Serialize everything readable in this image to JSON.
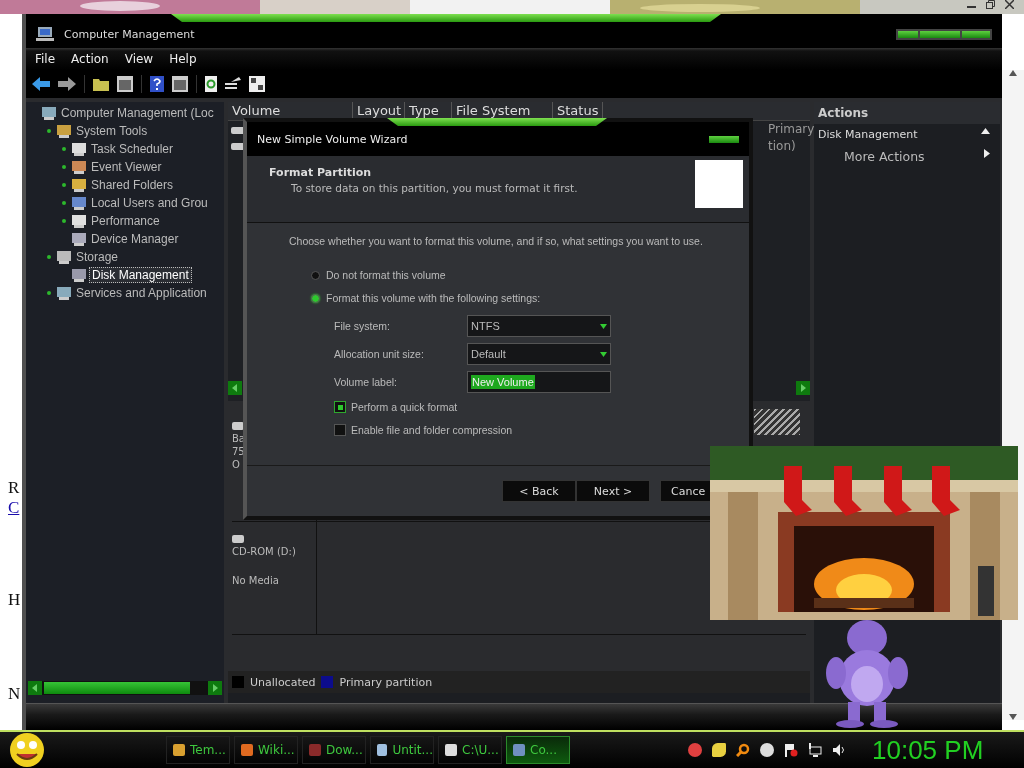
{
  "background_page": {
    "fragments": [
      "R",
      "C",
      "H",
      "N"
    ]
  },
  "window": {
    "title": "Computer Management",
    "menu": [
      "File",
      "Action",
      "View",
      "Help"
    ]
  },
  "tree": [
    {
      "label": "Computer Management (Loc",
      "expandable": false,
      "selected": false,
      "children": [
        {
          "label": "System Tools",
          "expandable": true,
          "selected": false,
          "children": [
            {
              "label": "Task Scheduler",
              "expandable": true,
              "selected": false
            },
            {
              "label": "Event Viewer",
              "expandable": true,
              "selected": false
            },
            {
              "label": "Shared Folders",
              "expandable": true,
              "selected": false
            },
            {
              "label": "Local Users and Grou",
              "expandable": true,
              "selected": false
            },
            {
              "label": "Performance",
              "expandable": true,
              "selected": false
            },
            {
              "label": "Device Manager",
              "expandable": false,
              "selected": false
            }
          ]
        },
        {
          "label": "Storage",
          "expandable": true,
          "selected": false,
          "children": [
            {
              "label": "Disk Management",
              "expandable": false,
              "selected": true
            }
          ]
        },
        {
          "label": "Services and Application",
          "expandable": true,
          "selected": false
        }
      ]
    }
  ],
  "volume_list": {
    "columns": [
      "Volume",
      "Layout",
      "Type",
      "File System",
      "Status"
    ],
    "visible_fragments": [
      "Primary",
      "tion)"
    ]
  },
  "disk_map": {
    "disks": [
      {
        "lines": [
          "Ba",
          "75",
          "O"
        ]
      },
      {
        "lines": [
          "CD-ROM (D:)",
          "No Media"
        ]
      }
    ],
    "legend": [
      {
        "label": "Unallocated",
        "color": "#000000"
      },
      {
        "label": "Primary partition",
        "color": "#0c0c8c"
      }
    ]
  },
  "actions": {
    "title": "Actions",
    "items": [
      {
        "label": "Disk Management",
        "kind": "section"
      },
      {
        "label": "More Actions",
        "kind": "link"
      }
    ]
  },
  "wizard": {
    "title": "New Simple Volume Wizard",
    "heading": "Format Partition",
    "subtitle": "To store data on this partition, you must format it first.",
    "instruction": "Choose whether you want to format this volume, and if so, what settings you want to use.",
    "options": [
      {
        "label": "Do not format this volume",
        "selected": false
      },
      {
        "label": "Format this volume with the following settings:",
        "selected": true
      }
    ],
    "fields": [
      {
        "label": "File system:",
        "value": "NTFS",
        "kind": "dropdown"
      },
      {
        "label": "Allocation unit size:",
        "value": "Default",
        "kind": "dropdown"
      },
      {
        "label": "Volume label:",
        "value": "New Volume",
        "kind": "text"
      }
    ],
    "checks": [
      {
        "label": "Perform a quick format",
        "checked": true
      },
      {
        "label": "Enable file and folder compression",
        "checked": false
      }
    ],
    "buttons": [
      "< Back",
      "Next >",
      "Cance"
    ]
  },
  "taskbar": {
    "tasks": [
      {
        "label": "Tem...",
        "selected": false
      },
      {
        "label": "Wiki...",
        "selected": false
      },
      {
        "label": "Dow...",
        "selected": false
      },
      {
        "label": "Untit...",
        "selected": false
      },
      {
        "label": "C:\\U...",
        "selected": false
      },
      {
        "label": "Co...",
        "selected": true
      }
    ],
    "clock": "10:05 PM"
  }
}
